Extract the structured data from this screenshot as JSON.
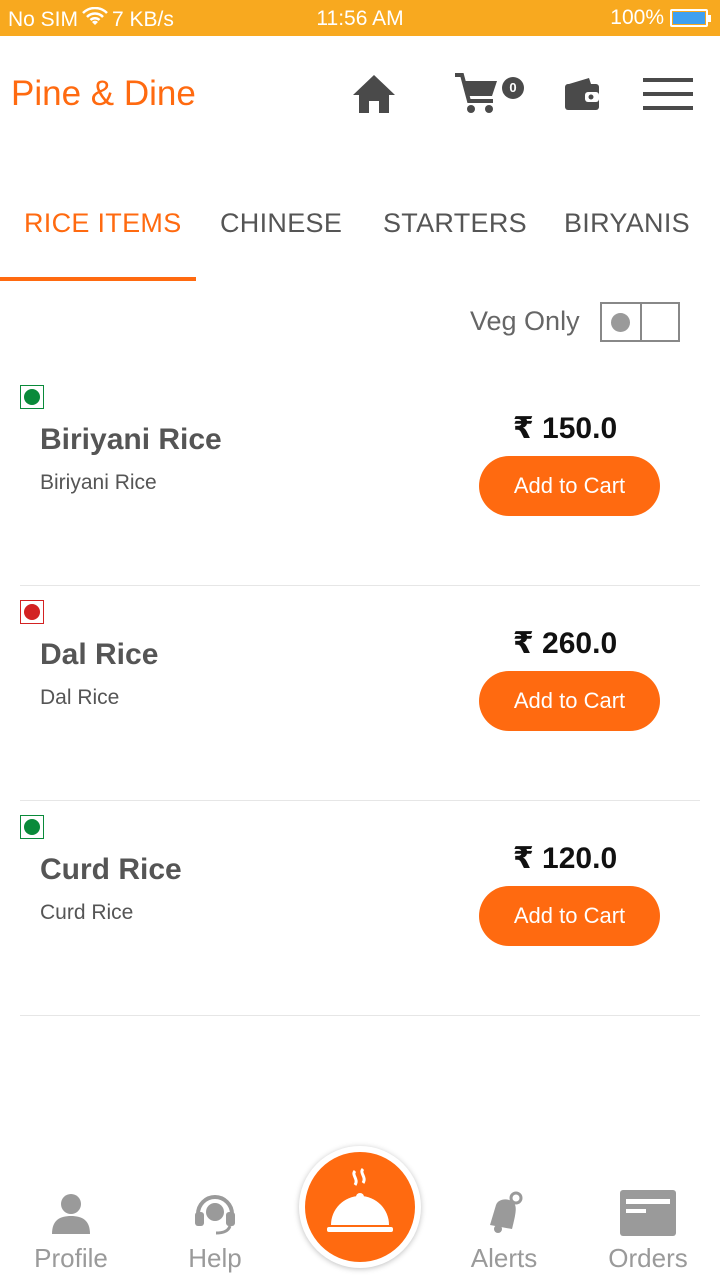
{
  "status_bar": {
    "carrier": "No SIM",
    "speed": "7 KB/s",
    "time": "11:56 AM",
    "battery": "100%"
  },
  "app_bar": {
    "brand": "Pine & Dine",
    "cart_count": "0",
    "icons": [
      "home-icon",
      "cart-icon",
      "wallet-icon",
      "menu-icon"
    ]
  },
  "tabs": [
    {
      "label": "RICE ITEMS",
      "active": true
    },
    {
      "label": "CHINESE",
      "active": false
    },
    {
      "label": "STARTERS",
      "active": false
    },
    {
      "label": "BIRYANIS",
      "active": false
    }
  ],
  "filter": {
    "veg_only_label": "Veg Only",
    "veg_only_on": false
  },
  "items": [
    {
      "name": "Biriyani Rice",
      "description": "Biriyani Rice",
      "price": "₹ 150.0",
      "veg": true,
      "button": "Add to Cart"
    },
    {
      "name": "Dal Rice",
      "description": "Dal Rice",
      "price": "₹ 260.0",
      "veg": false,
      "button": "Add to Cart"
    },
    {
      "name": "Curd Rice",
      "description": "Curd Rice",
      "price": "₹ 120.0",
      "veg": true,
      "button": "Add to Cart"
    }
  ],
  "bottom_nav": [
    {
      "label": "Profile",
      "icon": "person-icon"
    },
    {
      "label": "Help",
      "icon": "headset-icon"
    },
    {
      "label": "Alerts",
      "icon": "bell-icon"
    },
    {
      "label": "Orders",
      "icon": "orders-icon"
    }
  ],
  "colors": {
    "accent": "#ff6a10",
    "status_bar": "#f8a91f",
    "veg_green": "#0a8a3a",
    "nonveg_red": "#d32222",
    "nav_grey": "#9a9a9a"
  }
}
